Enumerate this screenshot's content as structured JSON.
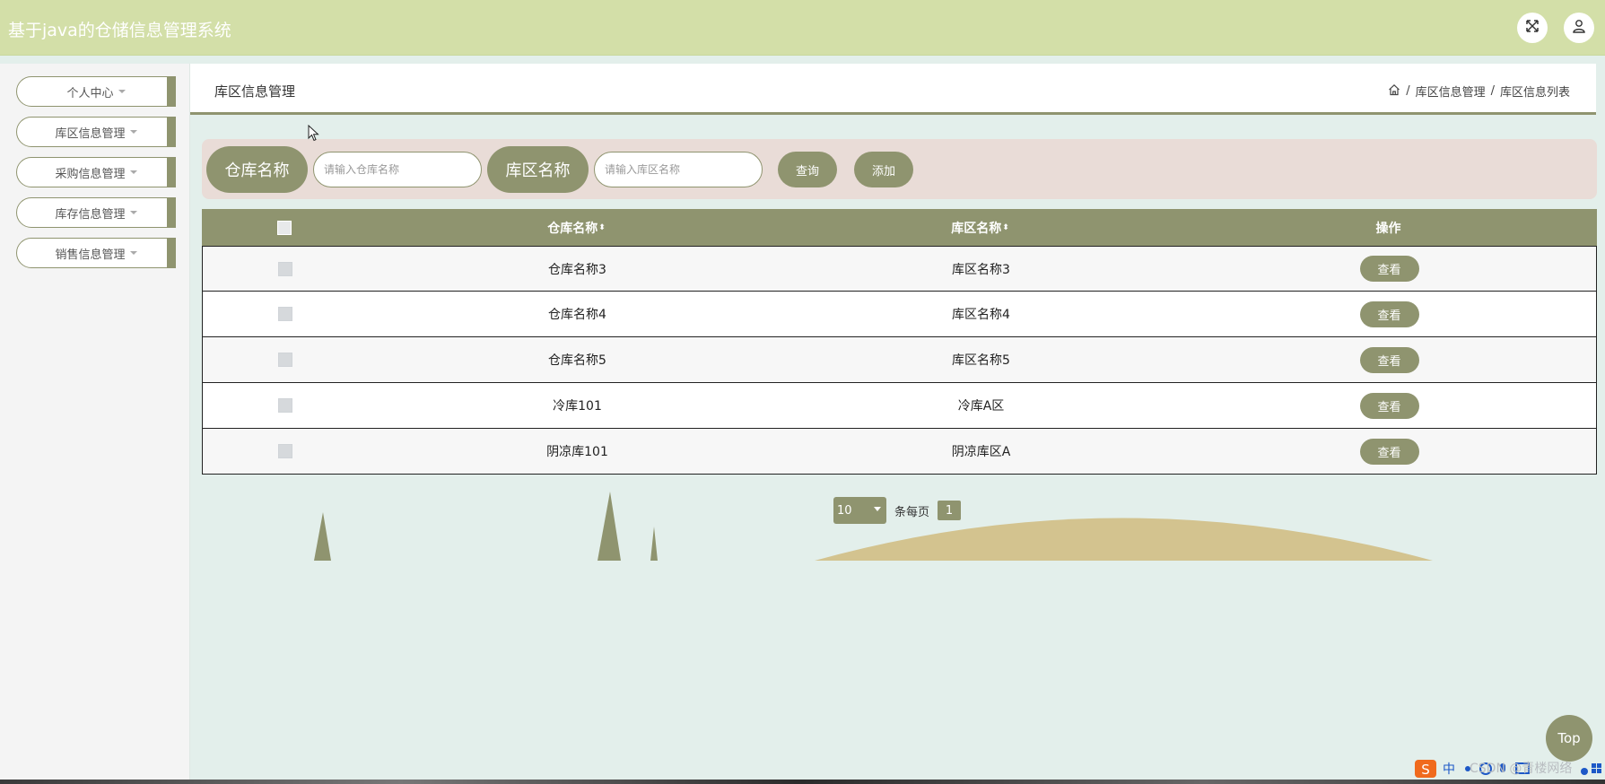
{
  "header": {
    "app_title": "基于java的仓储信息管理系统",
    "fullscreen_icon": "expand-arrows-icon",
    "user_icon": "user-icon"
  },
  "sidebar": {
    "items": [
      {
        "label": "个人中心"
      },
      {
        "label": "库区信息管理"
      },
      {
        "label": "采购信息管理"
      },
      {
        "label": "库存信息管理"
      },
      {
        "label": "销售信息管理"
      }
    ]
  },
  "breadcrumb": {
    "page_title": "库区信息管理",
    "home_icon": "home-icon",
    "path": [
      "库区信息管理",
      "库区信息列表"
    ],
    "separator": "/"
  },
  "search": {
    "warehouse_label": "仓库名称",
    "warehouse_placeholder": "请输入仓库名称",
    "warehouse_value": "",
    "zone_label": "库区名称",
    "zone_placeholder": "请输入库区名称",
    "zone_value": "",
    "query_button": "查询",
    "add_button": "添加"
  },
  "table": {
    "columns": [
      "",
      "仓库名称",
      "库区名称",
      "操作"
    ],
    "sort_glyph": "⬍",
    "rows": [
      {
        "warehouse": "仓库名称3",
        "zone": "库区名称3",
        "action": "查看"
      },
      {
        "warehouse": "仓库名称4",
        "zone": "库区名称4",
        "action": "查看"
      },
      {
        "warehouse": "仓库名称5",
        "zone": "库区名称5",
        "action": "查看"
      },
      {
        "warehouse": "冷库101",
        "zone": "冷库A区",
        "action": "查看"
      },
      {
        "warehouse": "阴凉库101",
        "zone": "阴凉库区A",
        "action": "查看"
      }
    ]
  },
  "pagination": {
    "page_size": "10",
    "page_size_options": [
      "10"
    ],
    "per_page_label": "条每页",
    "current_page": "1"
  },
  "back_to_top": "Top",
  "watermark": "CSDN @青楼网络",
  "colors": {
    "header_bg": "#d3dfa8",
    "accent": "#8f946f",
    "search_bg": "#e9dcd7",
    "page_bg": "#e3efeb",
    "hill": "#d3c38f"
  }
}
